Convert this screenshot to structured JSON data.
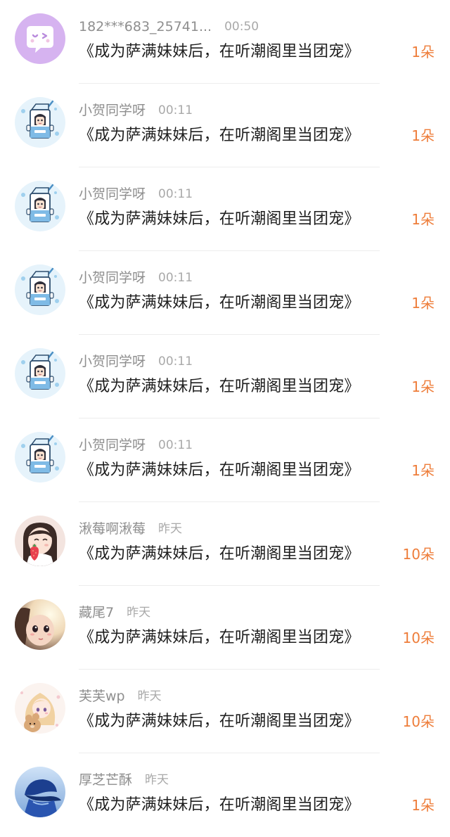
{
  "colors": {
    "accent": "#ee7d3a",
    "username": "#8e8e8e",
    "time": "#a9a9a9",
    "title": "#1f1f1f"
  },
  "rows": [
    {
      "avatar": "wink-speech-bubble-avatar",
      "username": "182***683_25741...",
      "time": "00:50",
      "book": "《成为萨满妹妹后，在听潮阁里当团宠》",
      "amount": "1朵"
    },
    {
      "avatar": "milk-carton-avatar",
      "username": "小贺同学呀",
      "time": "00:11",
      "book": "《成为萨满妹妹后，在听潮阁里当团宠》",
      "amount": "1朵"
    },
    {
      "avatar": "milk-carton-avatar",
      "username": "小贺同学呀",
      "time": "00:11",
      "book": "《成为萨满妹妹后，在听潮阁里当团宠》",
      "amount": "1朵"
    },
    {
      "avatar": "milk-carton-avatar",
      "username": "小贺同学呀",
      "time": "00:11",
      "book": "《成为萨满妹妹后，在听潮阁里当团宠》",
      "amount": "1朵"
    },
    {
      "avatar": "milk-carton-avatar",
      "username": "小贺同学呀",
      "time": "00:11",
      "book": "《成为萨满妹妹后，在听潮阁里当团宠》",
      "amount": "1朵"
    },
    {
      "avatar": "milk-carton-avatar",
      "username": "小贺同学呀",
      "time": "00:11",
      "book": "《成为萨满妹妹后，在听潮阁里当团宠》",
      "amount": "1朵"
    },
    {
      "avatar": "girl-with-strawberry-avatar",
      "username": "湫莓啊湫莓",
      "time": "昨天",
      "book": "《成为萨满妹妹后，在听潮阁里当团宠》",
      "amount": "10朵"
    },
    {
      "avatar": "glowing-face-avatar",
      "username": "藏尾7",
      "time": "昨天",
      "book": "《成为萨满妹妹后，在听潮阁里当团宠》",
      "amount": "10朵"
    },
    {
      "avatar": "anime-girl-with-bear-avatar",
      "username": "芙芙wp",
      "time": "昨天",
      "book": "《成为萨满妹妹后，在听潮阁里当团宠》",
      "amount": "10朵"
    },
    {
      "avatar": "blue-cap-avatar",
      "username": "厚芝芒酥",
      "time": "昨天",
      "book": "《成为萨满妹妹后，在听潮阁里当团宠》",
      "amount": "1朵"
    }
  ]
}
